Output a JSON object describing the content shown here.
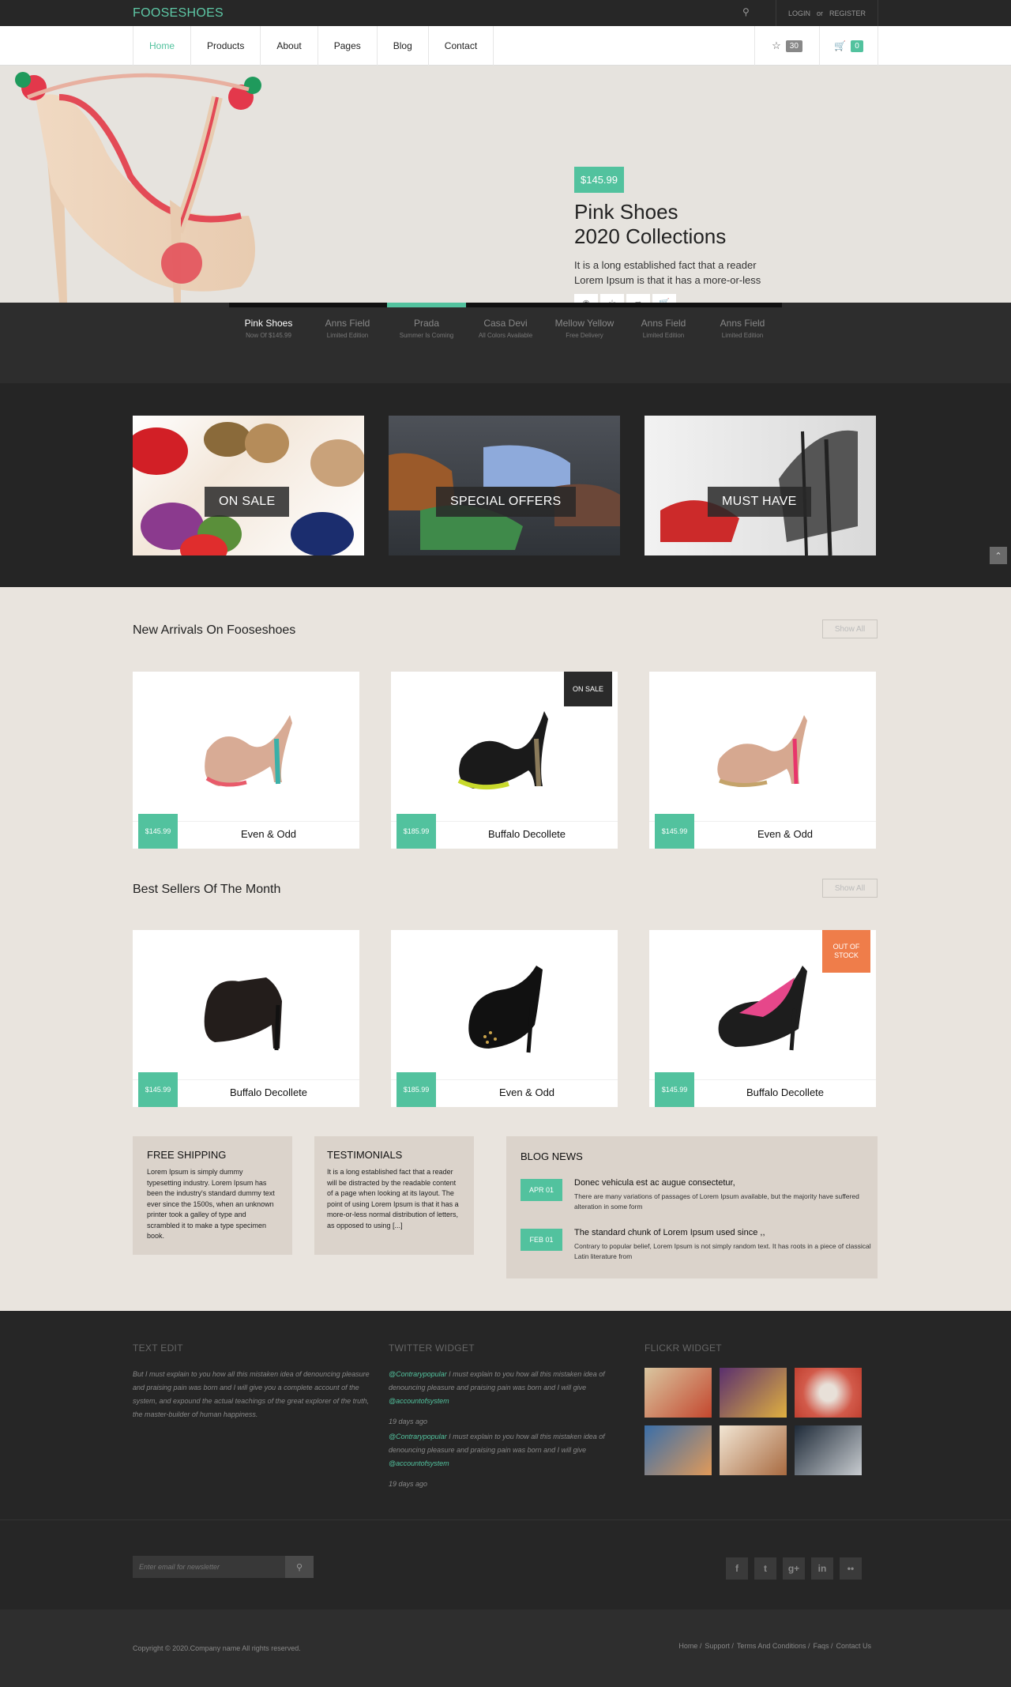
{
  "brand": {
    "logo": "FOOSESHOES",
    "accent": "#52c29e"
  },
  "topbar": {
    "login": "LOGIN",
    "or": "or",
    "register": "REGISTER"
  },
  "nav": {
    "items": [
      "Home",
      "Products",
      "About",
      "Pages",
      "Blog",
      "Contact"
    ],
    "active": "Home",
    "wishlist_count": "30",
    "cart_count": "0"
  },
  "hero": {
    "price": "$145.99",
    "title_line1": "Pink Shoes",
    "title_line2": "2020 Collections",
    "description": "It is a long established fact that a reader Lorem Ipsum is that it has a more-or-less",
    "actions": [
      "eye-icon",
      "star-icon",
      "share-icon",
      "cart-icon"
    ]
  },
  "slider_tabs": [
    {
      "title": "Pink Shoes",
      "sub": "Now Of $145.99"
    },
    {
      "title": "Anns Field",
      "sub": "Limited Edition"
    },
    {
      "title": "Prada",
      "sub": "Summer Is Coming"
    },
    {
      "title": "Casa Devi",
      "sub": "All Colors Available"
    },
    {
      "title": "Mellow Yellow",
      "sub": "Free Delivery"
    },
    {
      "title": "Anns Field",
      "sub": "Limited Edition"
    },
    {
      "title": "Anns Field",
      "sub": "Limited Edition"
    }
  ],
  "categories": [
    {
      "label": "ON SALE"
    },
    {
      "label": "SPECIAL OFFERS"
    },
    {
      "label": "MUST HAVE"
    }
  ],
  "new_arrivals": {
    "title": "New Arrivals On Fooseshoes",
    "show_all": "Show All",
    "products": [
      {
        "price": "$145.99",
        "name": "Even & Odd",
        "tag": ""
      },
      {
        "price": "$185.99",
        "name": "Buffalo Decollete",
        "tag": "ON SALE"
      },
      {
        "price": "$145.99",
        "name": "Even & Odd",
        "tag": ""
      }
    ]
  },
  "best_sellers": {
    "title": "Best Sellers Of The Month",
    "show_all": "Show All",
    "products": [
      {
        "price": "$145.99",
        "name": "Buffalo Decollete",
        "tag": ""
      },
      {
        "price": "$185.99",
        "name": "Even & Odd",
        "tag": ""
      },
      {
        "price": "$145.99",
        "name": "Buffalo Decollete",
        "tag": "OUT OF STOCK"
      }
    ]
  },
  "free_shipping": {
    "title": "FREE SHIPPING",
    "text": "Lorem Ipsum is simply dummy typesetting industry. Lorem Ipsum has been the industry's standard dummy text ever since the 1500s, when an unknown printer took a galley of type and scrambled it to make a type specimen book."
  },
  "testimonials": {
    "title": "TESTIMONIALS",
    "text": "It is a long established fact that a reader will be distracted by the readable content of a page when looking at its layout. The point of using Lorem Ipsum is that it has a more-or-less normal distribution of letters, as opposed to using [...]"
  },
  "blog": {
    "title": "BLOG NEWS",
    "posts": [
      {
        "date": "APR 01",
        "title": "Donec vehicula est ac augue consectetur,",
        "text": "There are many variations of passages of Lorem Ipsum available, but the majority have suffered alteration in some form"
      },
      {
        "date": "FEB 01",
        "title": "The standard chunk of Lorem Ipsum used since ,,",
        "text": "Contrary to popular belief, Lorem Ipsum is not simply random text. It has roots in a piece of classical Latin literature from"
      }
    ]
  },
  "footer": {
    "text_edit": {
      "title": "TEXT EDIT",
      "text": "But I must explain to you how all this mistaken idea of denouncing pleasure and praising pain was born and I will give you a complete account of the system, and expound the actual teachings of the great explorer of the truth, the master-builder of human happiness."
    },
    "twitter": {
      "title": "TWITTER WIDGET",
      "tweets": [
        {
          "handle": "@Contrarypopular",
          "text": " I must explain to you how all this mistaken idea of denouncing pleasure and praising pain was born and I will give ",
          "mention": "@accountofsystem",
          "ago": "19 days ago"
        },
        {
          "handle": "@Contrarypopular",
          "text": " I must explain to you how all this mistaken idea of denouncing pleasure and praising pain was born and I will give ",
          "mention": "@accountofsystem",
          "ago": "19 days ago"
        }
      ]
    },
    "flickr": {
      "title": "FLICKR WIDGET"
    },
    "newsletter_placeholder": "Enter email for newsletter",
    "social": [
      "f",
      "t",
      "g+",
      "in",
      "••"
    ],
    "copyright": "Copyright © 2020.Company name All rights reserved.",
    "links": [
      "Home /",
      "Support /",
      "Terms And Conditions /",
      "Faqs /",
      "Contact Us"
    ]
  }
}
